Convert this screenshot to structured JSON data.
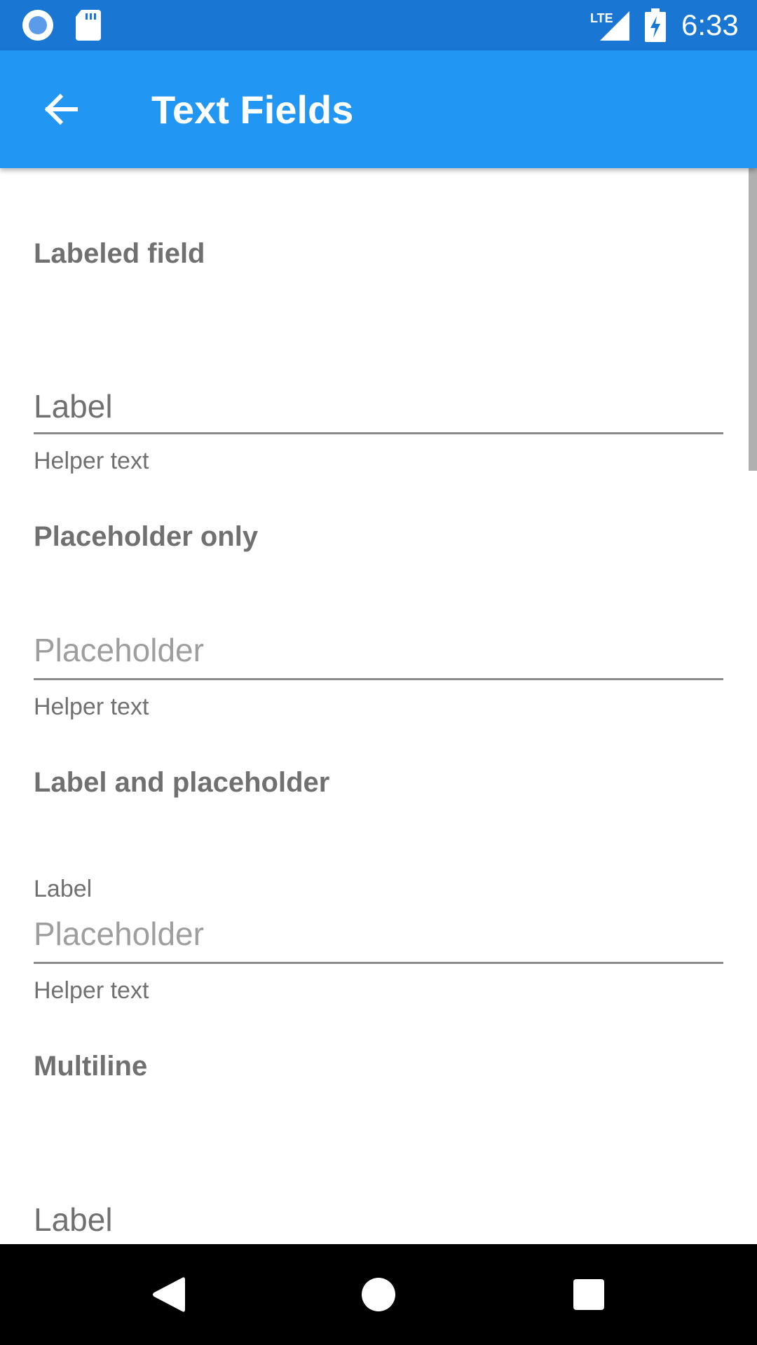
{
  "status_bar": {
    "time": "6:33",
    "network": "LTE",
    "icons": [
      "notification-circle-icon",
      "sd-card-icon",
      "lte-signal-icon",
      "battery-charging-icon"
    ]
  },
  "app_bar": {
    "title": "Text Fields",
    "back_icon": "arrow-back-icon",
    "color": "#2196f3",
    "status_color": "#1976d2"
  },
  "sections": [
    {
      "title": "Labeled field",
      "label": "Label",
      "helper": "Helper text"
    },
    {
      "title": "Placeholder only",
      "placeholder": "Placeholder",
      "helper": "Helper text"
    },
    {
      "title": "Label and placeholder",
      "label": "Label",
      "placeholder": "Placeholder",
      "helper": "Helper text"
    },
    {
      "title": "Multiline",
      "label": "Label"
    }
  ],
  "nav_bar": {
    "icons": [
      "back-triangle-icon",
      "home-circle-icon",
      "recents-square-icon"
    ]
  }
}
